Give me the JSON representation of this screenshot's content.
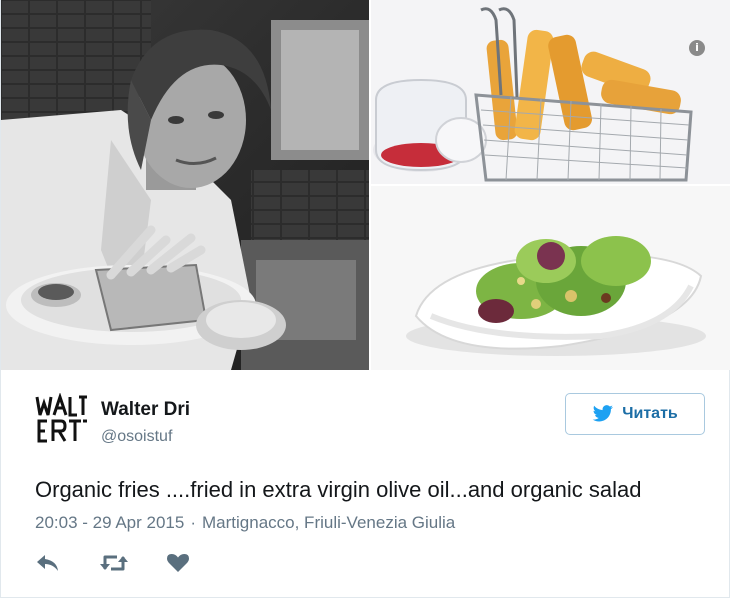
{
  "user": {
    "name": "Walter Dri",
    "handle": "@osoistuf",
    "avatar_text": "WALTER"
  },
  "follow_button": {
    "label": "Читать"
  },
  "tweet": {
    "text": "Organic fries ....fried in extra virgin olive oil...and organic salad",
    "time": "20:03 - 29 Apr 2015",
    "separator": "·",
    "location": "Martignacco, Friuli-Venezia Giulia"
  },
  "media": {
    "info_glyph": "i",
    "photos": [
      "chef-with-fries",
      "fries-in-basket",
      "salad-bowl"
    ]
  },
  "icons": [
    "info-icon",
    "twitter-bird-icon",
    "reply-icon",
    "retweet-icon",
    "like-icon"
  ],
  "colors": {
    "name": "#14171a",
    "secondary_text": "#657786",
    "button_text": "#1c6ea6",
    "button_border": "#a9c9df",
    "action_icons": "#5a6f7e"
  }
}
